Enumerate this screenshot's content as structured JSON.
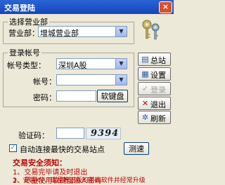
{
  "window": {
    "title": "交易登陆",
    "close_label": "×"
  },
  "branch": {
    "legend": "选择营业部",
    "label": "营业部：",
    "value": "增城营业部"
  },
  "login": {
    "legend": "登录帐号",
    "account_type_label": "帐号类型：",
    "account_type_value": "深圳A股",
    "account_label": "帐号：",
    "account_value": "",
    "password_label": "密码：",
    "softkbd_label": "软键盘",
    "captcha_label": "验证码：",
    "captcha_value": "",
    "captcha_image_text": "9394"
  },
  "side": {
    "station": "总站",
    "settings": "设置",
    "login": "登录",
    "exit": "退出",
    "refresh": "刷新"
  },
  "options": {
    "auto_connect_label": "自动连接最快的交易站点",
    "auto_connect_checked": true,
    "speedtest_label": "测速"
  },
  "notice": {
    "title": "交易安全须知：",
    "items": [
      "1、交易完毕请及时退出",
      "2、尽量使用软键盘输入密码",
      "3、安装KV、瑞星等正版的杀毒软件并经常升级"
    ]
  }
}
